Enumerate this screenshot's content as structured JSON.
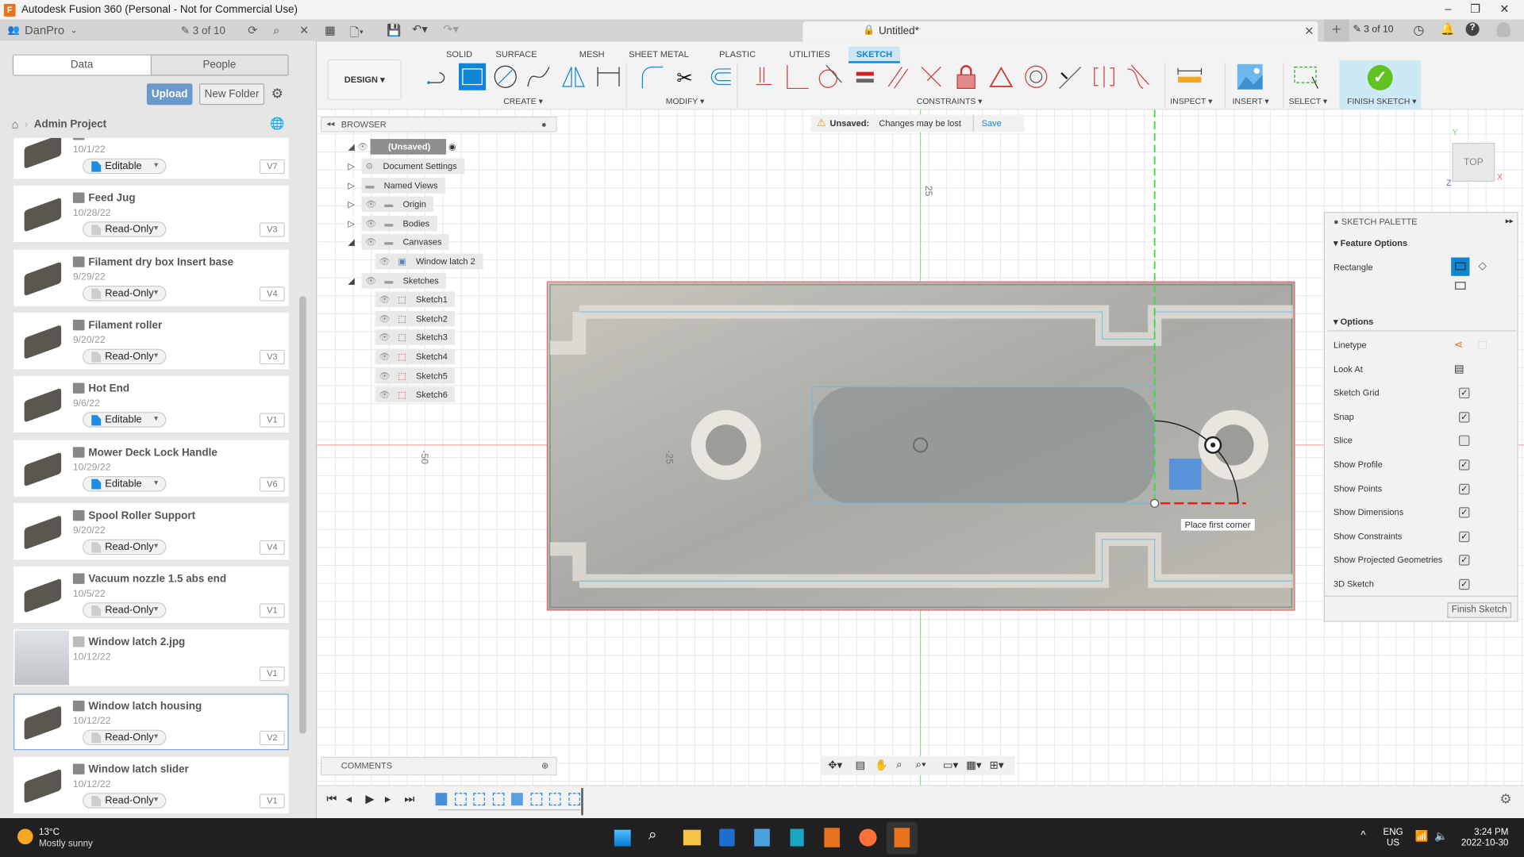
{
  "window": {
    "title": "Autodesk Fusion 360 (Personal - Not for Commercial Use)"
  },
  "data_panel": {
    "team": "DanPro",
    "version_count": "3 of 10",
    "tabs": [
      "Data",
      "People"
    ],
    "upload": "Upload",
    "new_folder": "New Folder",
    "breadcrumb": "Admin Project",
    "items": [
      {
        "name": "",
        "date": "10/1/22",
        "permission": "Editable",
        "version": "V7",
        "kind": "design"
      },
      {
        "name": "Feed Jug",
        "date": "10/28/22",
        "permission": "Read-Only",
        "version": "V3",
        "kind": "design"
      },
      {
        "name": "Filament dry box Insert base",
        "date": "9/29/22",
        "permission": "Read-Only",
        "version": "V4",
        "kind": "design"
      },
      {
        "name": "Filament roller",
        "date": "9/20/22",
        "permission": "Read-Only",
        "version": "V3",
        "kind": "design"
      },
      {
        "name": "Hot End",
        "date": "9/6/22",
        "permission": "Editable",
        "version": "V1",
        "kind": "design"
      },
      {
        "name": "Mower Deck Lock Handle",
        "date": "10/29/22",
        "permission": "Editable",
        "version": "V6",
        "kind": "design"
      },
      {
        "name": "Spool Roller Support",
        "date": "9/20/22",
        "permission": "Read-Only",
        "version": "V4",
        "kind": "design"
      },
      {
        "name": "Vacuum nozzle 1.5 abs end",
        "date": "10/5/22",
        "permission": "Read-Only",
        "version": "V1",
        "kind": "design"
      },
      {
        "name": "Window latch 2.jpg",
        "date": "10/12/22",
        "permission": "",
        "version": "V1",
        "kind": "image"
      },
      {
        "name": "Window latch housing",
        "date": "10/12/22",
        "permission": "Read-Only",
        "version": "V2",
        "kind": "design",
        "selected": true
      },
      {
        "name": "Window latch slider",
        "date": "10/12/22",
        "permission": "Read-Only",
        "version": "V1",
        "kind": "design"
      }
    ]
  },
  "document": {
    "title": "Untitled*",
    "version_count": "3 of 10"
  },
  "toolbar": {
    "workspace": "DESIGN ▾",
    "tabs": [
      "SOLID",
      "SURFACE",
      "MESH",
      "SHEET METAL",
      "PLASTIC",
      "UTILITIES",
      "SKETCH"
    ],
    "active_tab": "SKETCH",
    "groups": {
      "create": "CREATE ▾",
      "modify": "MODIFY ▾",
      "constraints": "CONSTRAINTS ▾",
      "inspect": "INSPECT ▾",
      "insert": "INSERT ▾",
      "select": "SELECT ▾",
      "finish": "FINISH SKETCH ▾"
    }
  },
  "browser": {
    "title": "BROWSER",
    "root": "(Unsaved)",
    "nodes": [
      "Document Settings",
      "Named Views",
      "Origin",
      "Bodies",
      "Canvases",
      "Window latch 2",
      "Sketches",
      "Sketch1",
      "Sketch2",
      "Sketch3",
      "Sketch4",
      "Sketch5",
      "Sketch6"
    ]
  },
  "warning": {
    "label": "Unsaved:",
    "message": "Changes may be lost",
    "action": "Save"
  },
  "canvas": {
    "axis_labels": [
      "25",
      "-25",
      "-50"
    ],
    "tooltip": "Place first corner",
    "view_cube": "TOP",
    "axes": [
      "X",
      "Y",
      "Z"
    ]
  },
  "palette": {
    "title": "SKETCH PALETTE",
    "feature_options": "Feature Options",
    "rectangle": "Rectangle",
    "options": "Options",
    "rows": [
      {
        "label": "Linetype",
        "type": "icons"
      },
      {
        "label": "Look At",
        "type": "icon"
      },
      {
        "label": "Sketch Grid",
        "checked": true
      },
      {
        "label": "Snap",
        "checked": true
      },
      {
        "label": "Slice",
        "checked": false
      },
      {
        "label": "Show Profile",
        "checked": true
      },
      {
        "label": "Show Points",
        "checked": true
      },
      {
        "label": "Show Dimensions",
        "checked": true
      },
      {
        "label": "Show Constraints",
        "checked": true
      },
      {
        "label": "Show Projected Geometries",
        "checked": true
      },
      {
        "label": "3D Sketch",
        "checked": true
      }
    ],
    "finish": "Finish Sketch"
  },
  "comments": {
    "title": "COMMENTS"
  },
  "taskbar": {
    "temp": "13°C",
    "weather": "Mostly sunny",
    "lang1": "ENG",
    "lang2": "US",
    "time": "3:24 PM",
    "date": "2022-10-30"
  },
  "colors": {
    "accent": "#0e86d4",
    "finish_green": "#5fc21e",
    "constraint_red": "#d33a3a",
    "upload_blue": "#6a99cc"
  }
}
